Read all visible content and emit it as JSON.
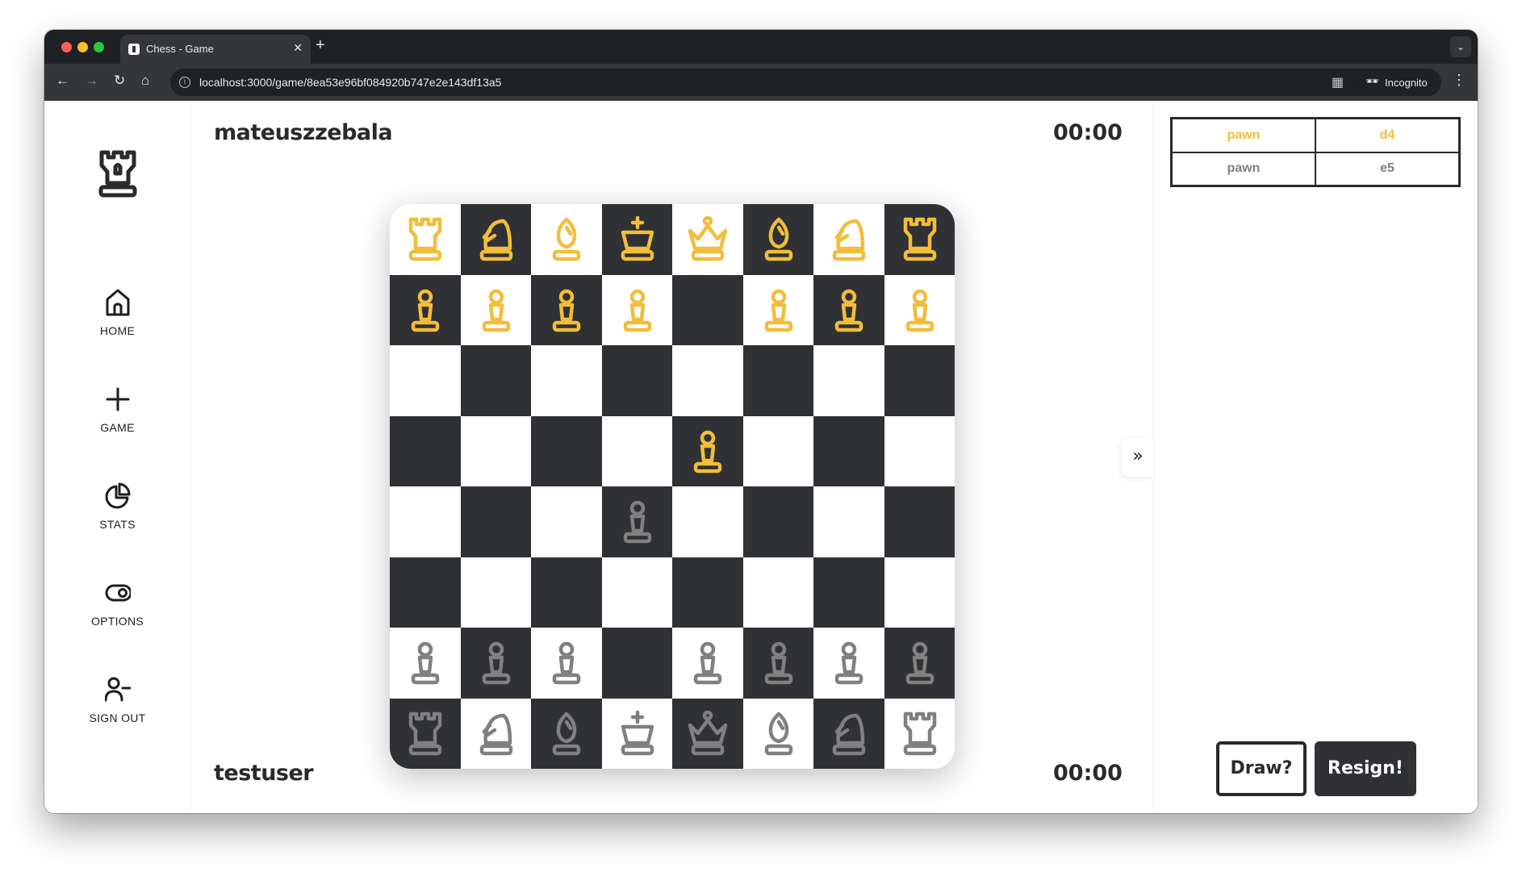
{
  "browser": {
    "tab_title": "Chess - Game",
    "url": "localhost:3000/game/8ea53e96bf084920b747e2e143df13a5",
    "incognito_label": "Incognito"
  },
  "sidebar": {
    "items": [
      {
        "label": "HOME",
        "icon": "home-icon"
      },
      {
        "label": "GAME",
        "icon": "plus-icon"
      },
      {
        "label": "STATS",
        "icon": "pie-chart-icon"
      },
      {
        "label": "OPTIONS",
        "icon": "toggle-icon"
      },
      {
        "label": "SIGN OUT",
        "icon": "user-minus-icon"
      }
    ]
  },
  "players": {
    "top": {
      "name": "mateuszzebala",
      "clock": "00:00"
    },
    "bottom": {
      "name": "testuser",
      "clock": "00:00"
    }
  },
  "board": {
    "rows": [
      [
        "yr",
        "yn",
        "yb",
        "yk",
        "yq",
        "yb",
        "yn",
        "yr"
      ],
      [
        "yp",
        "yp",
        "yp",
        "yp",
        "",
        "yp",
        "yp",
        "yp"
      ],
      [
        "",
        "",
        "",
        "",
        "",
        "",
        "",
        ""
      ],
      [
        "",
        "",
        "",
        "",
        "yp",
        "",
        "",
        ""
      ],
      [
        "",
        "",
        "",
        "gp",
        "",
        "",
        "",
        ""
      ],
      [
        "",
        "",
        "",
        "",
        "",
        "",
        "",
        ""
      ],
      [
        "gp",
        "gp",
        "gp",
        "",
        "gp",
        "gp",
        "gp",
        "gp"
      ],
      [
        "gr",
        "gn",
        "gb",
        "gk",
        "gq",
        "gb",
        "gn",
        "gr"
      ]
    ],
    "colors": {
      "yellow": "#f2bd3a",
      "gray": "#808080",
      "dark": "#303134",
      "light": "#ffffff"
    }
  },
  "moves": [
    {
      "piece": "pawn",
      "square": "d4",
      "color": "yellow"
    },
    {
      "piece": "pawn",
      "square": "e5",
      "color": "gray"
    }
  ],
  "actions": {
    "draw": "Draw?",
    "resign": "Resign!"
  }
}
